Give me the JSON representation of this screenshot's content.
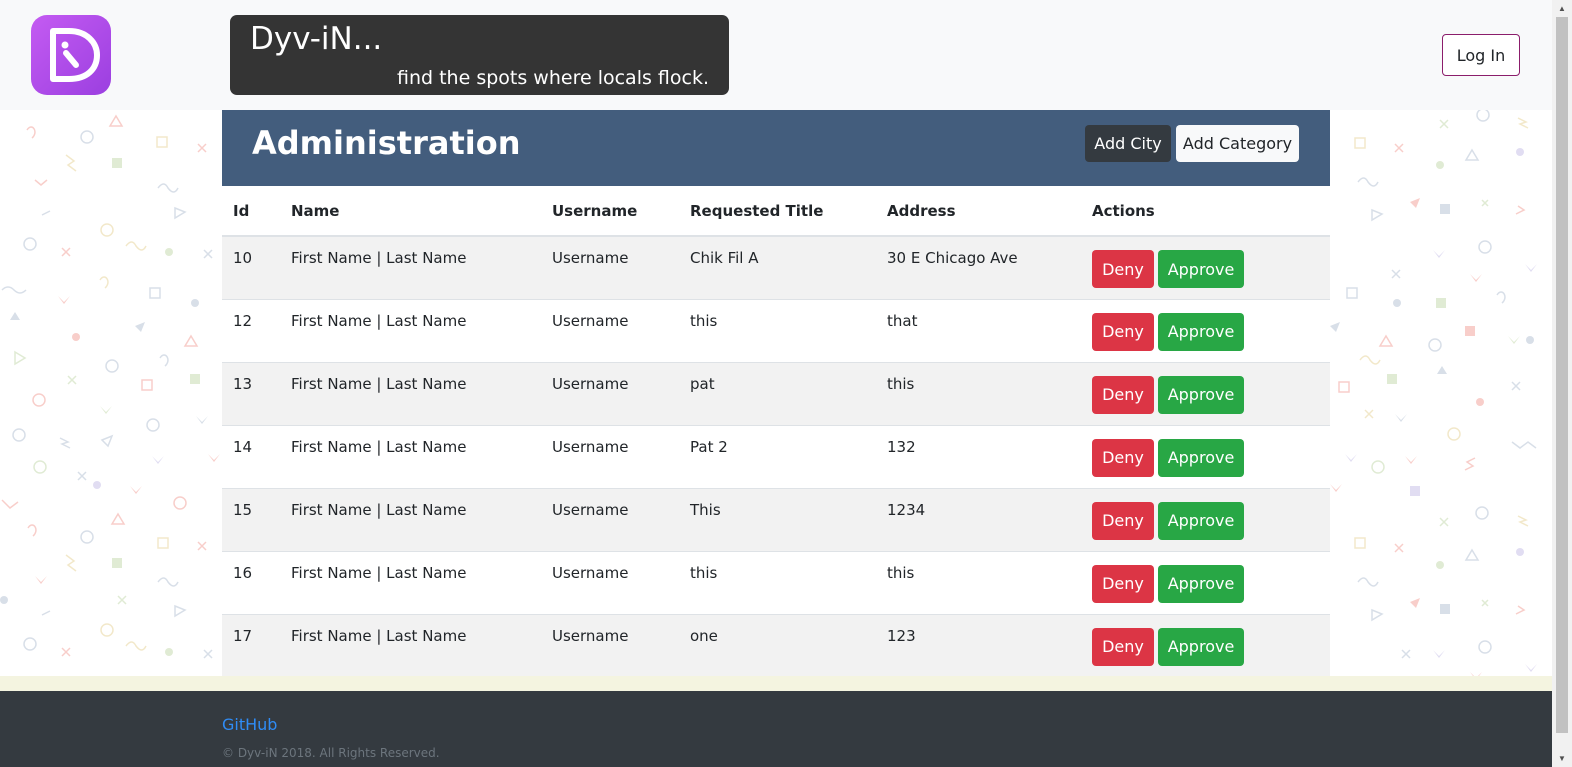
{
  "header": {
    "brand_title": "Dyv-iN...",
    "brand_tagline": "find the spots where locals flock.",
    "login_label": "Log In",
    "logo_color": "#c45bf2"
  },
  "admin": {
    "title": "Administration",
    "add_city_label": "Add City",
    "add_category_label": "Add Category",
    "header_color": "#435d7d",
    "columns": [
      "Id",
      "Name",
      "Username",
      "Requested Title",
      "Address",
      "Actions"
    ],
    "rows": [
      {
        "id": "10",
        "name": "First Name | Last Name",
        "username": "Username",
        "title": "Chik Fil A",
        "address": "30 E Chicago Ave"
      },
      {
        "id": "12",
        "name": "First Name | Last Name",
        "username": "Username",
        "title": "this",
        "address": "that"
      },
      {
        "id": "13",
        "name": "First Name | Last Name",
        "username": "Username",
        "title": "pat",
        "address": "this"
      },
      {
        "id": "14",
        "name": "First Name | Last Name",
        "username": "Username",
        "title": "Pat 2",
        "address": "132"
      },
      {
        "id": "15",
        "name": "First Name | Last Name",
        "username": "Username",
        "title": "This",
        "address": "1234"
      },
      {
        "id": "16",
        "name": "First Name | Last Name",
        "username": "Username",
        "title": "this",
        "address": "this"
      },
      {
        "id": "17",
        "name": "First Name | Last Name",
        "username": "Username",
        "title": "one",
        "address": "123"
      }
    ],
    "deny_label": "Deny",
    "approve_label": "Approve",
    "deny_color": "#dc3545",
    "approve_color": "#28a745"
  },
  "footer": {
    "link_label": "GitHub",
    "copyright": "© Dyv-iN 2018. All Rights Reserved."
  }
}
